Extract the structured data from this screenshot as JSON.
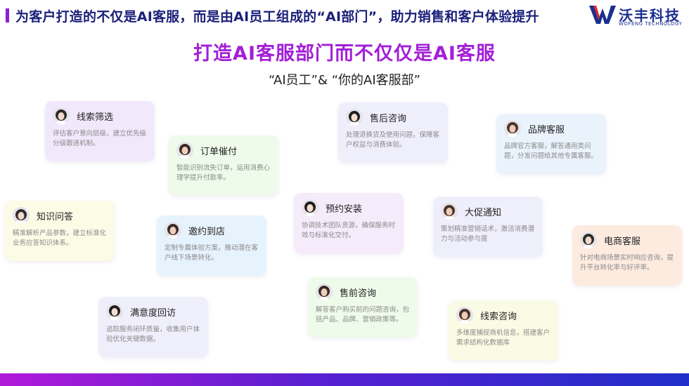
{
  "header": {
    "title": "为客户打造的不仅是AI客服，而是由AI员工组成的“AI部门”，助力销售和客户体验提升"
  },
  "logo": {
    "name_cn": "沃丰科技",
    "name_en": "WOFENG TECHNOLOGY"
  },
  "main": {
    "title": "打造AI客服部门而不仅仅是AI客服",
    "subtitle": "“AI员工”&  “你的AI客服部”"
  },
  "cards": [
    {
      "title": "线索筛选",
      "desc": "评估客户意向层级，建立优先级分级跟进机制。",
      "bg": "#f2e8fb"
    },
    {
      "title": "订单催付",
      "desc": "智能识别流失订单，运用消费心理学提升付款率。",
      "bg": "#eefbea"
    },
    {
      "title": "售后咨询",
      "desc": "处理退换货及使用问题，保障客户权益与消费体验。",
      "bg": "#efeefb"
    },
    {
      "title": "品牌客服",
      "desc": "品牌官方客服，解答通用类问题，分发问题给其他专属客服。",
      "bg": "#eaf3fc"
    },
    {
      "title": "知识问答",
      "desc": "精准解析产品参数，建立标准化业务应答知识体系。",
      "bg": "#fbfbe6"
    },
    {
      "title": "邀约到店",
      "desc": "定制专属体验方案，推动潜在客户线下场景转化。",
      "bg": "#e6f2fc"
    },
    {
      "title": "预约安装",
      "desc": "协调技术团队资源，确保服务时效与标准化交付。",
      "bg": "#f5ebfb"
    },
    {
      "title": "大促通知",
      "desc": "策划精准营销话术，激活消费潜力与活动参与度",
      "bg": "#efeefb"
    },
    {
      "title": "电商客服",
      "desc": "针对电商场景实时响应咨询，提升平台转化率与好评率。",
      "bg": "#fdebe0"
    },
    {
      "title": "售前咨询",
      "desc": "解答客户购买前的问题咨询，包括产品、品牌、营销政策等。",
      "bg": "#eefbea"
    },
    {
      "title": "满意度回访",
      "desc": "追踪服务闭环质量，收集用户体验优化关键数据。",
      "bg": "#efeefb"
    },
    {
      "title": "线索咨询",
      "desc": "多维度捕捉商机信息，搭建客户需求结构化数据库",
      "bg": "#fafbe4"
    }
  ]
}
